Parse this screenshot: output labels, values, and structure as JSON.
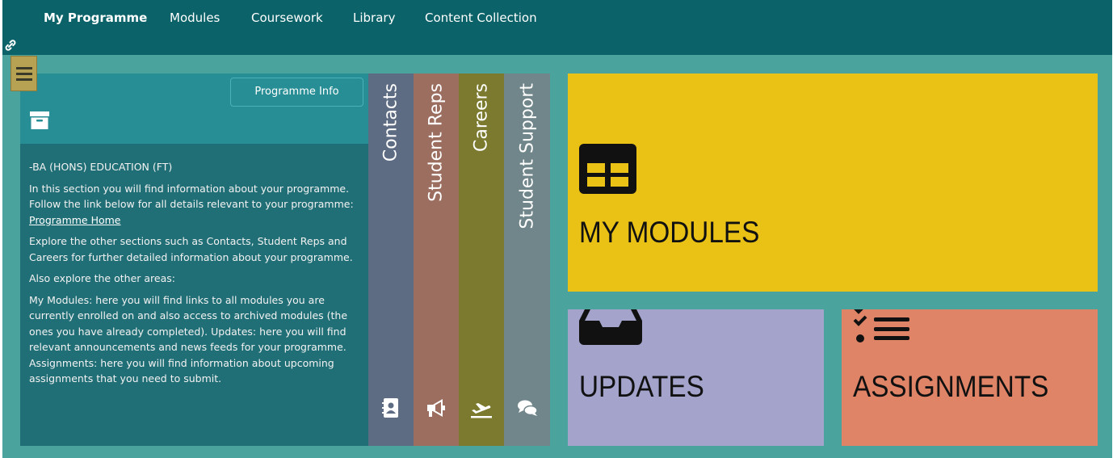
{
  "topnav": {
    "items": [
      {
        "label": "My Programme",
        "active": true
      },
      {
        "label": "Modules",
        "active": false
      },
      {
        "label": "Coursework",
        "active": false
      },
      {
        "label": "Library",
        "active": false
      },
      {
        "label": "Content Collection",
        "active": false
      }
    ]
  },
  "info_panel": {
    "button_label": "Programme Info",
    "programme_name": "-BA (HONS) EDUCATION (FT)",
    "intro_text": "In this section you will find information about your programme. Follow the link below for all details relevant to your programme: ",
    "link_text": "Programme Home",
    "explore_text": "Explore the other sections such as Contacts, Student Reps and Careers for further detailed information about your programme.",
    "also_text": "Also explore the other areas:",
    "areas_text": "My Modules: here you will find links to all modules you are currently enrolled on and also access to archived modules (the ones you have already completed). Updates: here you will find relevant announcements and news feeds for your programme. Assignments: here you will find information about upcoming assignments that you need to submit."
  },
  "vertical_tabs": [
    {
      "label": "Contacts",
      "icon": "contact-card-icon",
      "color": "#5e6c83"
    },
    {
      "label": "Student Reps",
      "icon": "megaphone-icon",
      "color": "#9b6e5f"
    },
    {
      "label": "Careers",
      "icon": "plane-departure-icon",
      "color": "#7b7a2e"
    },
    {
      "label": "Student Support",
      "icon": "chat-bubbles-icon",
      "color": "#70868a"
    }
  ],
  "tiles": {
    "my_modules": {
      "label": "MY MODULES",
      "icon": "table-grid-icon",
      "color": "#eac215"
    },
    "updates": {
      "label": "UPDATES",
      "icon": "inbox-tray-icon",
      "color": "#a3a3cc"
    },
    "assignments": {
      "label": "ASSIGNMENTS",
      "icon": "checklist-icon",
      "color": "#e08467"
    }
  },
  "colors": {
    "page_background": "#4aa39d",
    "nav_background": "#0b6269",
    "info_panel": "#216f76",
    "info_header": "#278e96",
    "menu_button": "#b7a152"
  }
}
